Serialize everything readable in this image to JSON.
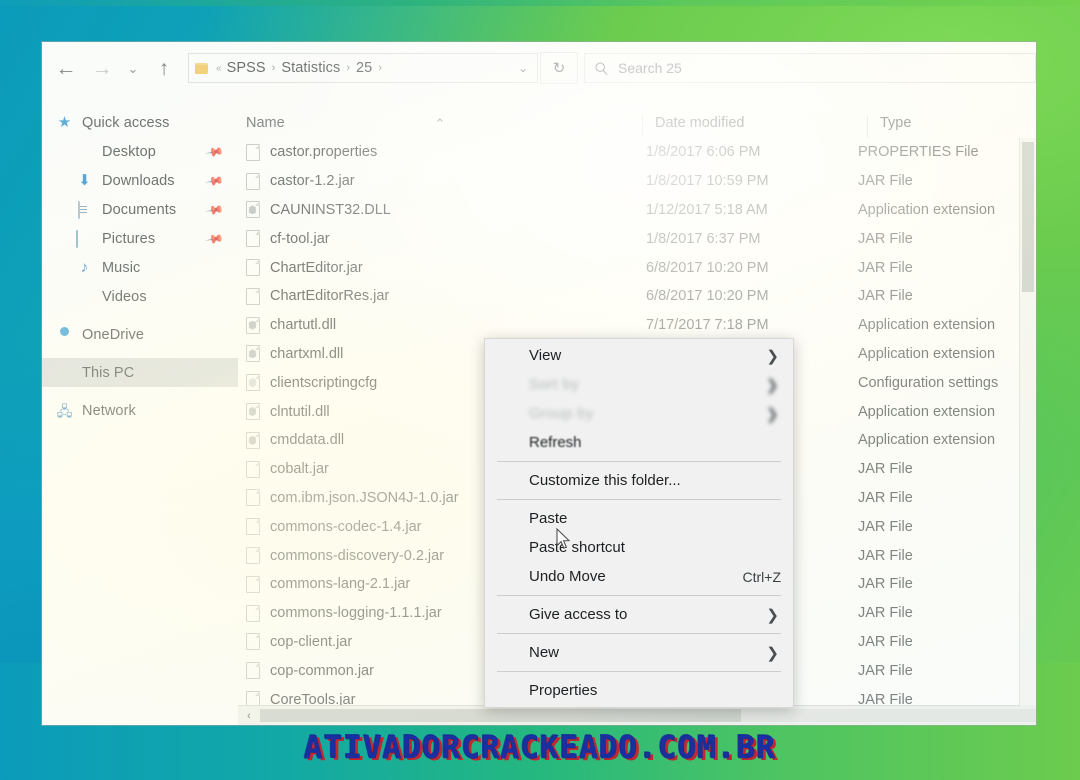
{
  "window": {
    "title": "25",
    "nav": {
      "back": "←",
      "forward": "→",
      "recent": "⌄",
      "up": "↑",
      "refresh": "↻"
    },
    "breadcrumb": {
      "overflow": "«",
      "items": [
        "SPSS",
        "Statistics",
        "25"
      ],
      "separator": "›",
      "dropdown": "⌄"
    },
    "search": {
      "placeholder": "Search 25",
      "icon": "search-icon"
    }
  },
  "sidebar": {
    "items": [
      {
        "label": "Quick access",
        "icon": "star-icon",
        "depth": 0,
        "pinned": false,
        "selected": false
      },
      {
        "label": "Desktop",
        "icon": "desktop-icon",
        "depth": 1,
        "pinned": true,
        "selected": false
      },
      {
        "label": "Downloads",
        "icon": "download-icon",
        "depth": 1,
        "pinned": true,
        "selected": false
      },
      {
        "label": "Documents",
        "icon": "document-icon",
        "depth": 1,
        "pinned": true,
        "selected": false
      },
      {
        "label": "Pictures",
        "icon": "pictures-icon",
        "depth": 1,
        "pinned": true,
        "selected": false
      },
      {
        "label": "Music",
        "icon": "music-icon",
        "depth": 1,
        "pinned": false,
        "selected": false
      },
      {
        "label": "Videos",
        "icon": "video-icon",
        "depth": 1,
        "pinned": false,
        "selected": false
      },
      {
        "label": "OneDrive",
        "icon": "cloud-icon",
        "depth": 0,
        "pinned": false,
        "selected": false
      },
      {
        "label": "This PC",
        "icon": "computer-icon",
        "depth": 0,
        "pinned": false,
        "selected": true
      },
      {
        "label": "Network",
        "icon": "network-icon",
        "depth": 0,
        "pinned": false,
        "selected": false
      }
    ],
    "pin_glyph": "📌"
  },
  "filelist": {
    "columns": [
      "Name",
      "Date modified",
      "Type"
    ],
    "sorted_column": "Name",
    "sort_caret": "⌃",
    "rows": [
      {
        "name": "castor.properties",
        "date": "1/8/2017 6:06 PM",
        "type": "PROPERTIES File",
        "icon": "file-icon"
      },
      {
        "name": "castor-1.2.jar",
        "date": "1/8/2017 10:59 PM",
        "type": "JAR File",
        "icon": "file-icon"
      },
      {
        "name": "CAUNINST32.DLL",
        "date": "1/12/2017 5:18 AM",
        "type": "Application extension",
        "icon": "dll-icon"
      },
      {
        "name": "cf-tool.jar",
        "date": "1/8/2017 6:37 PM",
        "type": "JAR File",
        "icon": "file-icon"
      },
      {
        "name": "ChartEditor.jar",
        "date": "6/8/2017 10:20 PM",
        "type": "JAR File",
        "icon": "file-icon"
      },
      {
        "name": "ChartEditorRes.jar",
        "date": "6/8/2017 10:20 PM",
        "type": "JAR File",
        "icon": "file-icon"
      },
      {
        "name": "chartutl.dll",
        "date": "7/17/2017 7:18 PM",
        "type": "Application extension",
        "icon": "dll-icon"
      },
      {
        "name": "chartxml.dll",
        "date": "",
        "type": "Application extension",
        "icon": "dll-icon"
      },
      {
        "name": "clientscriptingcfg",
        "date": "",
        "type": "Configuration settings",
        "icon": "config-icon"
      },
      {
        "name": "clntutil.dll",
        "date": "",
        "type": "Application extension",
        "icon": "dll-icon"
      },
      {
        "name": "cmddata.dll",
        "date": "",
        "type": "Application extension",
        "icon": "dll-icon"
      },
      {
        "name": "cobalt.jar",
        "date": "",
        "type": "JAR File",
        "icon": "file-icon"
      },
      {
        "name": "com.ibm.json.JSON4J-1.0.jar",
        "date": "",
        "type": "JAR File",
        "icon": "file-icon"
      },
      {
        "name": "commons-codec-1.4.jar",
        "date": "",
        "type": "JAR File",
        "icon": "file-icon"
      },
      {
        "name": "commons-discovery-0.2.jar",
        "date": "",
        "type": "JAR File",
        "icon": "file-icon"
      },
      {
        "name": "commons-lang-2.1.jar",
        "date": "",
        "type": "JAR File",
        "icon": "file-icon"
      },
      {
        "name": "commons-logging-1.1.1.jar",
        "date": "",
        "type": "JAR File",
        "icon": "file-icon"
      },
      {
        "name": "cop-client.jar",
        "date": "",
        "type": "JAR File",
        "icon": "file-icon"
      },
      {
        "name": "cop-common.jar",
        "date": "",
        "type": "JAR File",
        "icon": "file-icon"
      },
      {
        "name": "CoreTools.jar",
        "date": "",
        "type": "JAR File",
        "icon": "file-icon"
      }
    ],
    "hscroll_left_arrow": "‹"
  },
  "context_menu": {
    "items": [
      {
        "label": "View",
        "submenu": true,
        "accel": "",
        "state": "normal"
      },
      {
        "label": "Sort by",
        "submenu": true,
        "accel": "",
        "state": "blurred"
      },
      {
        "label": "Group by",
        "submenu": true,
        "accel": "",
        "state": "blurred"
      },
      {
        "label": "Refresh",
        "submenu": false,
        "accel": "",
        "state": "smear"
      },
      {
        "separator": true
      },
      {
        "label": "Customize this folder...",
        "submenu": false,
        "accel": "",
        "state": "normal"
      },
      {
        "separator": true
      },
      {
        "label": "Paste",
        "submenu": false,
        "accel": "",
        "state": "normal"
      },
      {
        "label": "Paste shortcut",
        "submenu": false,
        "accel": "",
        "state": "normal"
      },
      {
        "label": "Undo Move",
        "submenu": false,
        "accel": "Ctrl+Z",
        "state": "normal"
      },
      {
        "separator": true
      },
      {
        "label": "Give access to",
        "submenu": true,
        "accel": "",
        "state": "normal"
      },
      {
        "separator": true
      },
      {
        "label": "New",
        "submenu": true,
        "accel": "",
        "state": "normal"
      },
      {
        "separator": true
      },
      {
        "label": "Properties",
        "submenu": false,
        "accel": "",
        "state": "normal"
      }
    ],
    "submenu_arrow": "❯"
  },
  "watermark": {
    "text": "ATIVADORCRACKEADO.COM.BR"
  },
  "colors": {
    "flag_green": "#6ccc4e",
    "flag_blue": "#0b9bbb",
    "flag_yellow": "#fff3aa",
    "selection": "#bec4c4",
    "watermark_blue": "#1b2f9e",
    "watermark_red": "#c2272d"
  }
}
